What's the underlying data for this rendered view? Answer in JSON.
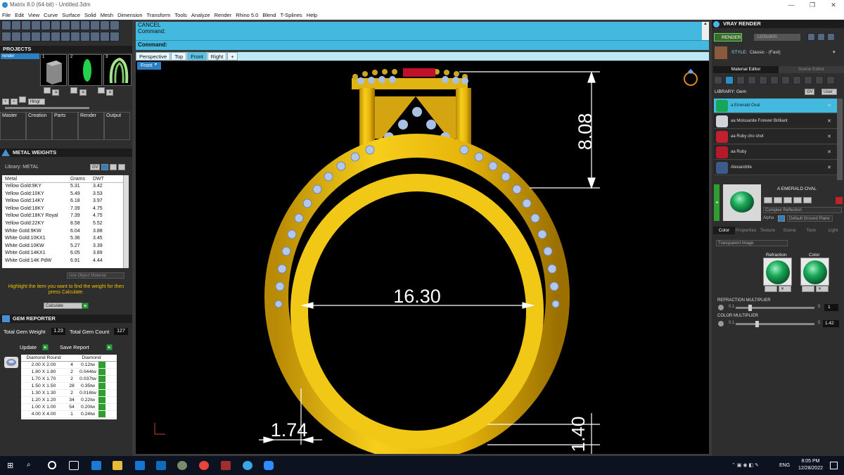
{
  "window": {
    "title": "Matrix 8.0 (64-bit) - Untitled.3dm"
  },
  "menu": [
    "File",
    "Edit",
    "View",
    "Curve",
    "Surface",
    "Solid",
    "Mesh",
    "Dimension",
    "Transform",
    "Tools",
    "Analyze",
    "Render",
    "Rhino 5.0",
    "Blend",
    "T-Splines",
    "Help"
  ],
  "projects": {
    "title": "PROJECTS",
    "selected": "render",
    "thumbs": [
      "1",
      "2",
      "3"
    ],
    "tool_label": "Hingr"
  },
  "workflow_tabs": [
    "Master",
    "Creation",
    "Parts",
    "Render",
    "Output"
  ],
  "metal_weights": {
    "title": "METAL WEIGHTS",
    "library": "Library: METAL",
    "dropdown": "GV",
    "columns": [
      "Metal",
      "Grams",
      "DWT"
    ],
    "rows": [
      [
        "Yellow Gold:9KY",
        "5.31",
        "3.42"
      ],
      [
        "Yellow Gold:10KY",
        "5.49",
        "3.53"
      ],
      [
        "Yellow Gold:14KY",
        "6.18",
        "3.97"
      ],
      [
        "Yellow Gold:18KY",
        "7.39",
        "4.75"
      ],
      [
        "Yellow Gold:18KY Royal",
        "7.39",
        "4.75"
      ],
      [
        "Yellow Gold:22KY",
        "8.58",
        "5.52"
      ],
      [
        "White Gold:9KW",
        "6.04",
        "3.88"
      ],
      [
        "White Gold:10KX1",
        "5.36",
        "3.45"
      ],
      [
        "White Gold:10KW",
        "5.27",
        "3.39"
      ],
      [
        "White Gold:14KX1",
        "6.05",
        "3.89"
      ],
      [
        "White Gold:14K PdW",
        "6.91",
        "4.44"
      ]
    ],
    "use_object_material": "Use Object Material",
    "hint": "Highlight the item you want to find the weight for then press Calculate.",
    "calculate": "Calculate"
  },
  "gem_reporter": {
    "title": "GEM REPORTER",
    "total_weight_label": "Total Gem Weight",
    "total_weight": "1.23",
    "total_count_label": "Total Gem Count",
    "total_count": "127",
    "update": "Update",
    "save_report": "Save Report",
    "columns": [
      "Diamond Round",
      "Diamond"
    ],
    "rows": [
      [
        "2.00 X 2.00",
        "4",
        "0.12tw"
      ],
      [
        "1.80 X 1.80",
        "2",
        "0.044tw"
      ],
      [
        "1.70 X 1.70",
        "2",
        "0.037tw"
      ],
      [
        "1.50 X 1.50",
        "28",
        "0.35tw"
      ],
      [
        "1.30 X 1.30",
        "2",
        "0.016tw"
      ],
      [
        "1.20 X 1.20",
        "34",
        "0.22tw"
      ],
      [
        "1.00 X 1.00",
        "54",
        "0.20tw"
      ],
      [
        "4.00 X 4.00",
        "1",
        "0.24tw"
      ]
    ]
  },
  "command": {
    "line1": "CANCEL",
    "line2": "Command:",
    "prompt": "Command:"
  },
  "viewport_tabs": [
    "Perspective",
    "Top",
    "Front",
    "Right",
    "+"
  ],
  "active_view": "Front",
  "view_label": "Front",
  "dimensions": {
    "height": "8.08",
    "width": "16.30",
    "band": "1.74",
    "thickness": "1.40"
  },
  "vray": {
    "title": "VRAY RENDER",
    "render_btn": "RENDER",
    "resolution": "1200x900",
    "style_label": "STYLE:",
    "style_value": "Classic - (Fast)",
    "tabs": [
      "Material Editor",
      "Scene Editor"
    ],
    "library": "LIBRARY: Gem",
    "dropdown": "GV",
    "user": "User",
    "materials": [
      {
        "name": "a Emerald Oval",
        "color": "#17a55a",
        "selected": true
      },
      {
        "name": "aa Moissanite Forever Brilliant",
        "color": "#cfd4d8",
        "selected": false
      },
      {
        "name": "aa Ruby cho shot",
        "color": "#c2202e",
        "selected": false
      },
      {
        "name": "aa Ruby",
        "color": "#b51a2a",
        "selected": false
      },
      {
        "name": "Alexandrite",
        "color": "#3c5a8a",
        "selected": false
      }
    ],
    "preview_title": "A EMERALD OVAL",
    "complex_reflection": "Complex Reflection",
    "alpha": "Alpha",
    "ground": "Default Ground Plane",
    "prop_tabs": [
      "Color",
      "Properties",
      "Texture",
      "Scene",
      "Toon",
      "Light"
    ],
    "transparent": "Transparent Image",
    "refraction_label": "Refraction",
    "color_label": "Color",
    "refraction_multiplier": "REFRACTION MULTIPLIER",
    "refr_min": "0.1",
    "refr_max": "5",
    "refr_val": "1",
    "color_multiplier": "COLOR MULTIPLIER",
    "col_min": "0.1",
    "col_max": "5",
    "col_val": "1.42"
  },
  "taskbar": {
    "lang": "ENG",
    "time": "8:05 PM",
    "date": "12/28/2022"
  }
}
